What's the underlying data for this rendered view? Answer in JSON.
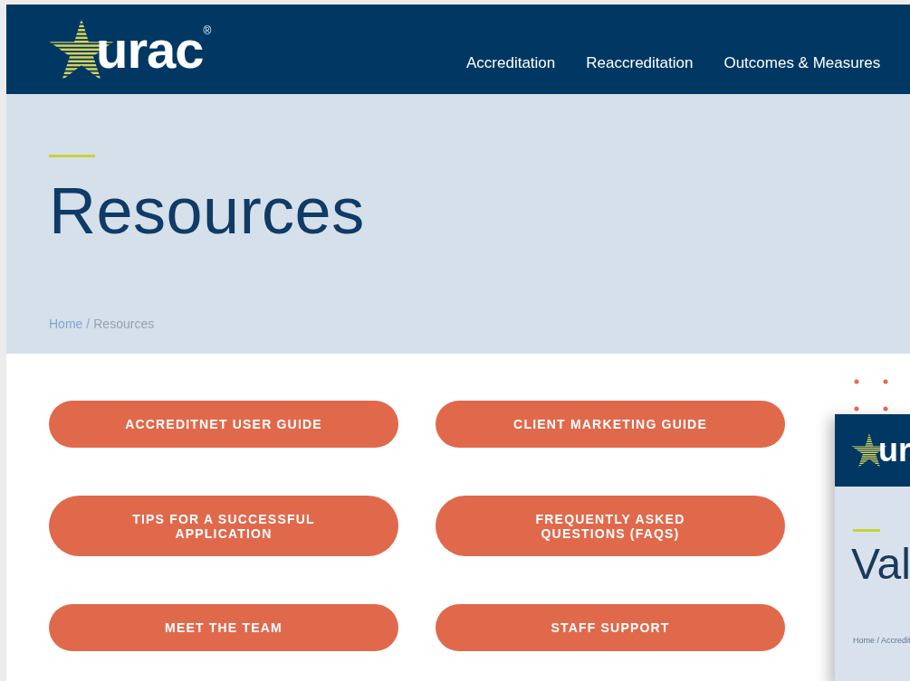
{
  "header": {
    "logo": {
      "text": "urac",
      "mark": "®"
    },
    "nav": [
      {
        "label": "Accreditation"
      },
      {
        "label": "Reaccreditation"
      },
      {
        "label": "Outcomes & Measures"
      }
    ]
  },
  "hero": {
    "title": "Resources",
    "breadcrumb": [
      {
        "label": "Home",
        "kind": "link"
      },
      {
        "label": "/",
        "kind": "separator"
      },
      {
        "label": "Resources",
        "kind": "current"
      }
    ]
  },
  "buttons": [
    {
      "label": "ACCREDITNET USER GUIDE"
    },
    {
      "label": "CLIENT MARKETING GUIDE"
    },
    {
      "label": "TIPS FOR A SUCCESSFUL APPLICATION"
    },
    {
      "label": "FREQUENTLY ASKED QUESTIONS (FAQS)"
    },
    {
      "label": "MEET THE TEAM"
    },
    {
      "label": "STAFF SUPPORT"
    }
  ],
  "preview": {
    "logo_text": "ur",
    "title": "Val",
    "breadcrumb": "Home / Accredit"
  }
}
